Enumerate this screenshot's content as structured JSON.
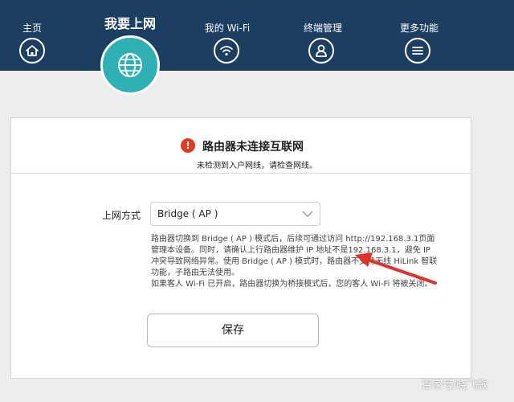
{
  "nav": {
    "items": [
      {
        "label": "主页",
        "icon": "home-icon"
      },
      {
        "label": "我要上网",
        "icon": "globe-icon"
      },
      {
        "label": "我的 Wi-Fi",
        "icon": "wifi-icon"
      },
      {
        "label": "终端管理",
        "icon": "user-icon"
      },
      {
        "label": "更多功能",
        "icon": "menu-icon"
      }
    ],
    "active_index": 1
  },
  "alert": {
    "icon": "!",
    "title": "路由器未连接互联网",
    "subtitle": "未检测到入户网线，请检查网线。"
  },
  "form": {
    "connection_label": "上网方式",
    "connection_value": "Bridge ( AP )",
    "description": "路由器切换到 Bridge ( AP ) 模式后，后续可通过访问 http://192.168.3.1页面管理本设备。同时，请确认上行路由器维护 IP 地址不是192.168.3.1，避免 IP 冲突导致网络异常。使用 Bridge ( AP ) 模式时，路由器不支持无线 HiLink 智联功能，子路由无法使用。",
    "guest_note": "如果客人 Wi-Fi 已开启，路由器切换为桥接模式后，您的客人 Wi-Fi 将被关闭。",
    "save_label": "保存"
  },
  "watermark": "百家号/晓飞歌",
  "colors": {
    "topbar": "#1c3e60",
    "active_tab": "#2eb0b4",
    "alert": "#e03c24",
    "arrow": "#e0312a"
  }
}
